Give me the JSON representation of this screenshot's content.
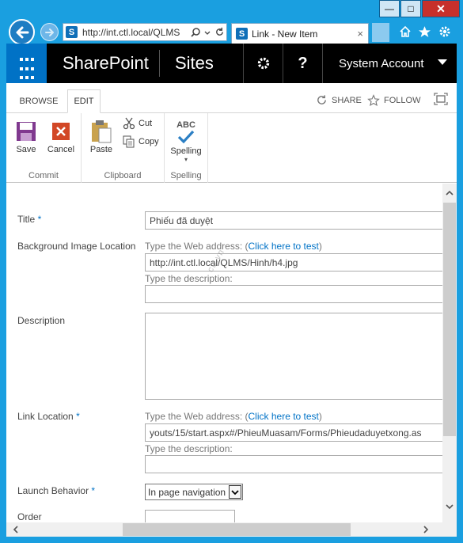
{
  "browser": {
    "address": "http://int.ctl.local/QLMS",
    "tab_title": "Link - New Item",
    "tab_close": "×",
    "minimize": "—",
    "maximize": "□",
    "close": "✕"
  },
  "suitebar": {
    "brand": "SharePoint",
    "sites": "Sites",
    "help": "?",
    "account": "System Account"
  },
  "ribbon": {
    "tabs": {
      "browse": "BROWSE",
      "edit": "EDIT"
    },
    "share": "SHARE",
    "follow": "FOLLOW",
    "groups": {
      "commit": {
        "label": "Commit",
        "save": "Save",
        "cancel": "Cancel"
      },
      "clipboard": {
        "label": "Clipboard",
        "paste": "Paste",
        "cut": "Cut",
        "copy": "Copy"
      },
      "spelling": {
        "label": "Spelling",
        "spelling": "Spelling",
        "abc": "ABC"
      }
    }
  },
  "form": {
    "title": {
      "label": "Title",
      "required": "*",
      "value": "Phiếu đã duyệt"
    },
    "bg_image": {
      "label": "Background Image Location",
      "hint_prefix": "Type the Web address: (",
      "test_link": "Click here to test",
      "hint_suffix": ")",
      "url_value": "http://int.ctl.local/QLMS/Hinh/h4.jpg",
      "desc_hint": "Type the description:",
      "desc_value": ""
    },
    "description": {
      "label": "Description",
      "value": ""
    },
    "link_location": {
      "label": "Link Location",
      "required": "*",
      "hint_prefix": "Type the Web address: (",
      "test_link": "Click here to test",
      "hint_suffix": ")",
      "url_value": "youts/15/start.aspx#/PhieuMuasam/Forms/Phieudaduyetxong.as",
      "desc_hint": "Type the description:",
      "desc_value": ""
    },
    "launch_behavior": {
      "label": "Launch Behavior",
      "required": "*",
      "selected": "In page navigation"
    },
    "order": {
      "label": "Order",
      "value": ""
    }
  },
  "watermark": "ctl.vn",
  "colors": {
    "window_frame": "#1a9fe0",
    "suitebar": "#000000",
    "waffle": "#0072c6",
    "link": "#0072c6",
    "close_button": "#c7302b"
  },
  "icons": [
    "back-arrow-icon",
    "forward-arrow-icon",
    "search-icon",
    "refresh-icon",
    "home-icon",
    "star-icon",
    "gear-icon",
    "share-icon",
    "follow-star-icon",
    "focus-icon",
    "save-icon",
    "cancel-icon",
    "paste-icon",
    "cut-icon",
    "copy-icon",
    "spelling-icon",
    "chevron-down-icon"
  ]
}
